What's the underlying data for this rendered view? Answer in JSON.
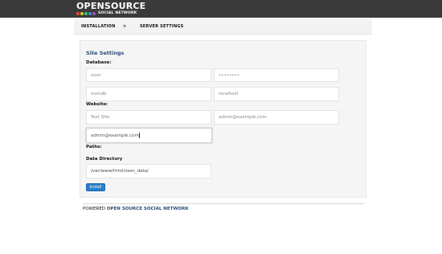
{
  "header": {
    "logo_title": "OPENSOURCE",
    "logo_subtitle": "SOCIAL NETWORK",
    "logo_dot_colors": [
      "#e74c3c",
      "#f1c40f",
      "#2ecc71",
      "#3498db",
      "#9b59b6"
    ]
  },
  "breadcrumb": {
    "step1": "INSTALLATION",
    "separator": ">",
    "step2": "SERVER SETTINGS"
  },
  "form": {
    "title": "Site Settings",
    "database_label": "Database:",
    "db_user": {
      "placeholder": "ossn"
    },
    "db_password": {
      "placeholder": "••••••••"
    },
    "db_name": {
      "placeholder": "ossndb"
    },
    "db_host": {
      "placeholder": "localhost"
    },
    "website_label": "Website:",
    "site_name": {
      "placeholder": "Test Site"
    },
    "owner_email": {
      "placeholder": "admin@example.com"
    },
    "notification_email": {
      "value": "admin@example.com"
    },
    "paths_label": "Paths:",
    "data_directory_label": "Data Directory",
    "data_directory": {
      "value": "/var/www/html/ossn_data/"
    },
    "install_button": "Install"
  },
  "footer": {
    "powered": "POWERED",
    "name": "OPEN SOURCE SOCIAL NETWORK"
  },
  "colors": {
    "topbar": "#3a3a3a",
    "accent": "#2a4e78",
    "button": "#2c7ec9"
  }
}
